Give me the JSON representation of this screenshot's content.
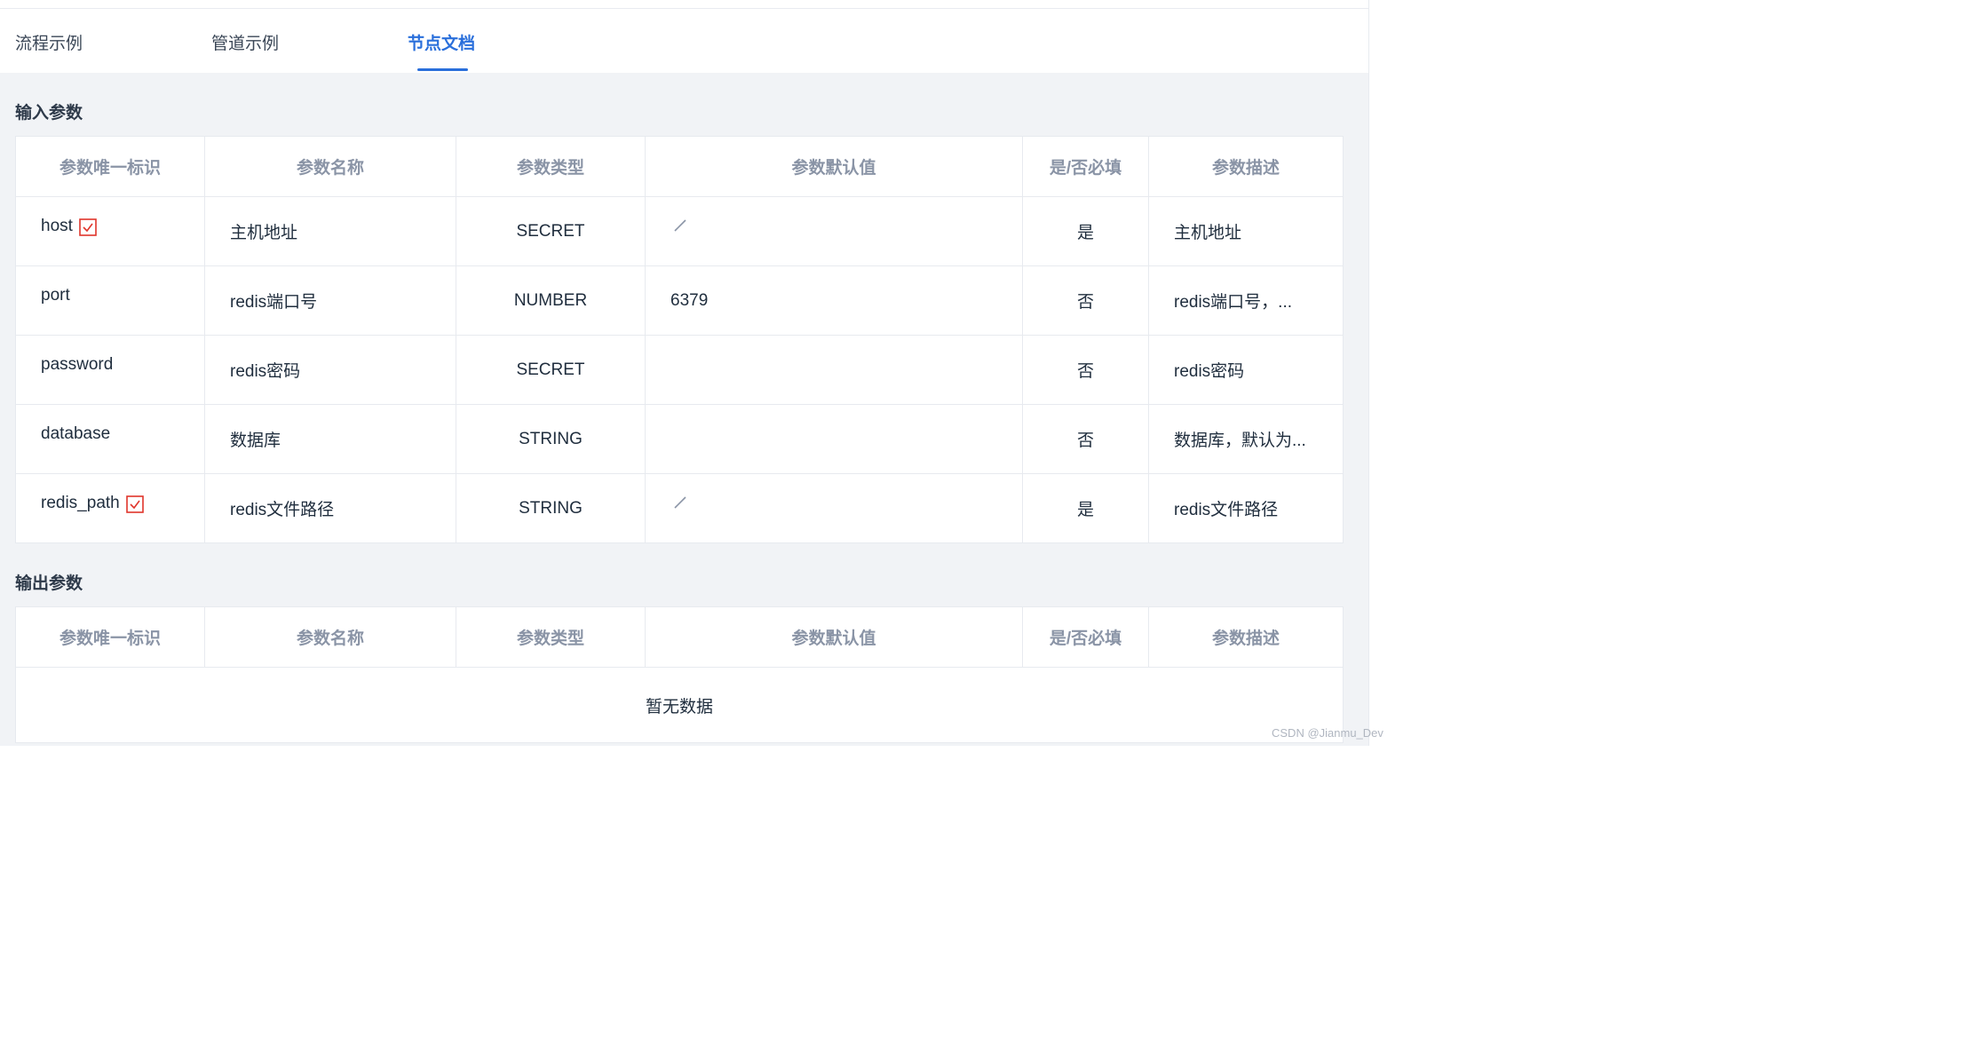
{
  "tabs": [
    {
      "label": "流程示例",
      "active": false
    },
    {
      "label": "管道示例",
      "active": false
    },
    {
      "label": "节点文档",
      "active": true
    }
  ],
  "input_section": {
    "title": "输入参数"
  },
  "output_section": {
    "title": "输出参数",
    "empty_text": "暂无数据"
  },
  "columns": [
    "参数唯一标识",
    "参数名称",
    "参数类型",
    "参数默认值",
    "是/否必填",
    "参数描述"
  ],
  "input_rows": [
    {
      "id": "host",
      "name": "主机地址",
      "type": "SECRET",
      "default": "",
      "required": "是",
      "description": "主机地址",
      "required_icon": "required-check-icon",
      "default_icon": "edit-pen-icon"
    },
    {
      "id": "port",
      "name": "redis端口号",
      "type": "NUMBER",
      "default": "6379",
      "required": "否",
      "description": "redis端口号，..."
    },
    {
      "id": "password",
      "name": "redis密码",
      "type": "SECRET",
      "default": "",
      "required": "否",
      "description": "redis密码"
    },
    {
      "id": "database",
      "name": "数据库",
      "type": "STRING",
      "default": "",
      "required": "否",
      "description": "数据库，默认为..."
    },
    {
      "id": "redis_path",
      "name": "redis文件路径",
      "type": "STRING",
      "default": "",
      "required": "是",
      "description": "redis文件路径",
      "required_icon": "required-check-icon",
      "default_icon": "edit-pen-icon"
    }
  ],
  "colors": {
    "accent": "#2a6fdb",
    "required_red": "#e0352b",
    "header_text": "#8a94a6",
    "background": "#f1f3f6"
  },
  "watermark": "CSDN @Jianmu_Dev"
}
